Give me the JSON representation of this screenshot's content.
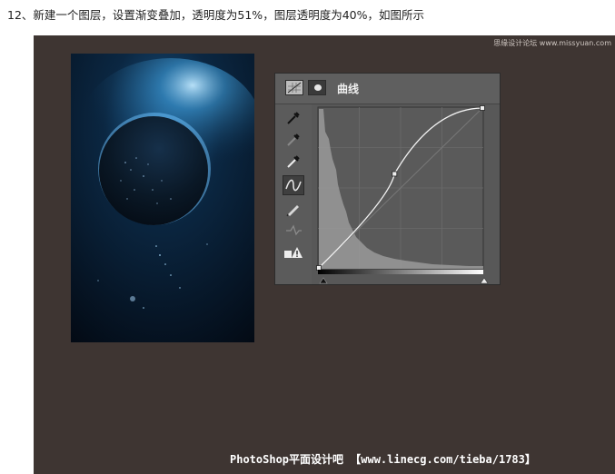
{
  "caption": "12、新建一个图层，设置渐变叠加，透明度为51%，图层透明度为40%，如图所示",
  "watermark_top": "思缘设计论坛 www.missyuan.com",
  "panel": {
    "title": "曲线",
    "tools": [
      {
        "name": "eyedropper-icon"
      },
      {
        "name": "eyedropper-gray-icon"
      },
      {
        "name": "eyedropper-white-icon"
      },
      {
        "name": "curve-point-icon",
        "active": true
      },
      {
        "name": "pencil-icon"
      },
      {
        "name": "smooth-icon"
      },
      {
        "name": "clipping-warning-icon"
      }
    ],
    "curve": {
      "points": [
        [
          0,
          0
        ],
        [
          118,
          150
        ],
        [
          255,
          255
        ]
      ],
      "range": [
        0,
        255
      ]
    }
  },
  "watermark_footer": "PhotoShop平面设计吧 【www.linecg.com/tieba/1783】"
}
